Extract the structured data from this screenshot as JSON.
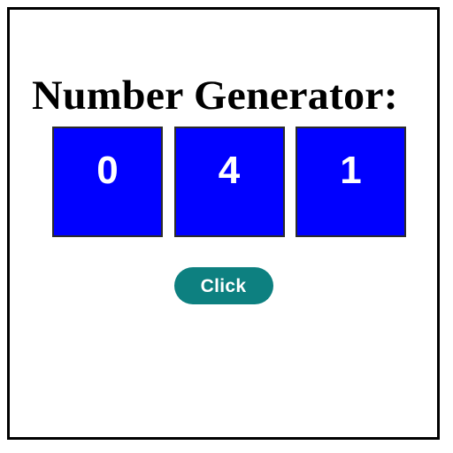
{
  "page": {
    "title": "Number Generator:",
    "background_color": "#ffffff",
    "border_color": "#000000"
  },
  "generator": {
    "heading": "Number Generator:",
    "digit_box_color": "#0000ff",
    "digit_text_color": "#ffffff",
    "digit_border_color": "#2b2b2b",
    "digits": [
      {
        "value": "0"
      },
      {
        "value": "4"
      },
      {
        "value": "1"
      }
    ]
  },
  "controls": {
    "click_button_label": "Click",
    "click_button_color": "#0d8080",
    "click_button_text_color": "#ffffff"
  }
}
